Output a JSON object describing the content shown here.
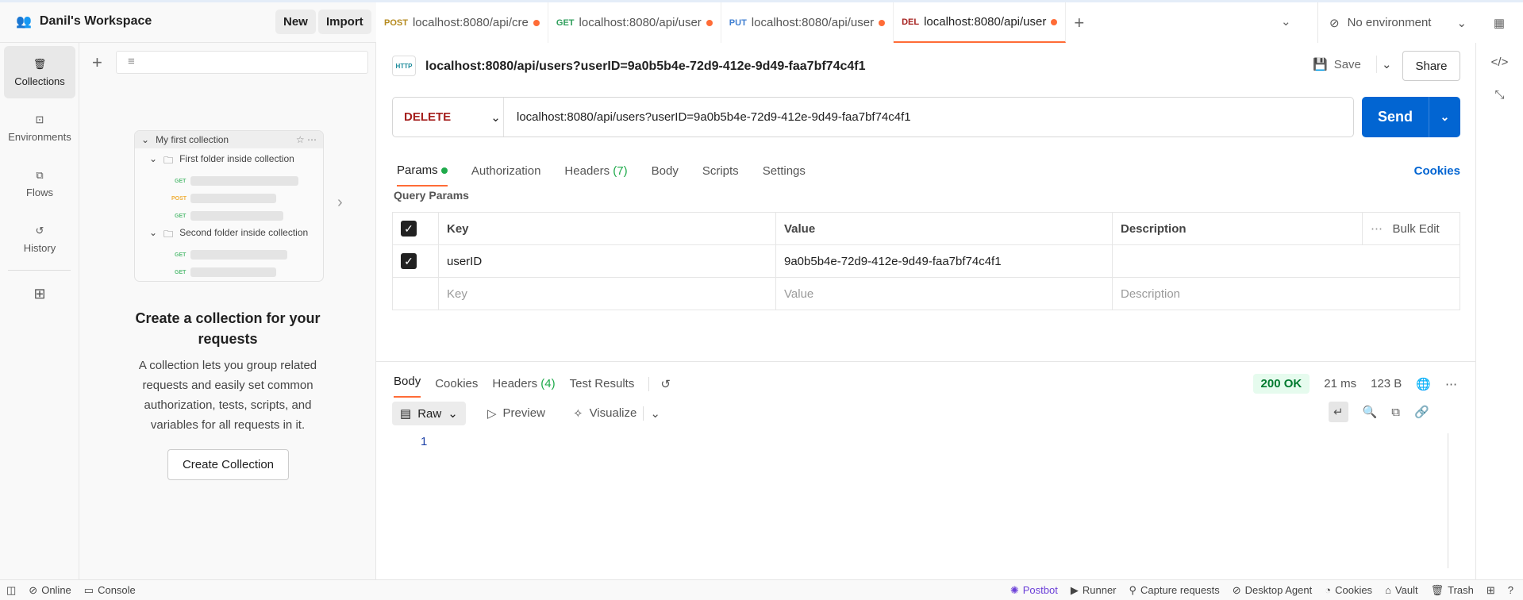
{
  "workspace": {
    "name": "Danil's Workspace",
    "new_label": "New",
    "import_label": "Import"
  },
  "tabs": [
    {
      "method": "POST",
      "url": "localhost:8080/api/cre",
      "color": "#b58a1e"
    },
    {
      "method": "GET",
      "url": "localhost:8080/api/user",
      "color": "#2e9e5b"
    },
    {
      "method": "PUT",
      "url": "localhost:8080/api/user",
      "color": "#3f7fd1"
    },
    {
      "method": "DEL",
      "url": "localhost:8080/api/user",
      "color": "#a5201e"
    }
  ],
  "environment": "No environment",
  "rail": [
    "Collections",
    "Environments",
    "Flows",
    "History"
  ],
  "sidebar": {
    "illustration": {
      "collection": "My first collection",
      "folder1": "First folder inside collection",
      "folder2": "Second folder inside collection",
      "m_get": "GET",
      "m_post": "POST"
    },
    "title": "Create a collection for your requests",
    "description": "A collection lets you group related requests and easily set common authorization, tests, scripts, and variables for all requests in it.",
    "button": "Create Collection"
  },
  "request": {
    "name": "localhost:8080/api/users?userID=9a0b5b4e-72d9-412e-9d49-faa7bf74c4f1",
    "save": "Save",
    "share": "Share",
    "method": "DELETE",
    "url": "localhost:8080/api/users?userID=9a0b5b4e-72d9-412e-9d49-faa7bf74c4f1",
    "send": "Send"
  },
  "req_tabs": {
    "params": "Params",
    "authorization": "Authorization",
    "headers": "Headers",
    "headers_count": "(7)",
    "body": "Body",
    "scripts": "Scripts",
    "settings": "Settings",
    "cookies": "Cookies"
  },
  "query": {
    "label": "Query Params",
    "headers": [
      "Key",
      "Value",
      "Description"
    ],
    "bulk": "Bulk Edit",
    "row": {
      "key": "userID",
      "value": "9a0b5b4e-72d9-412e-9d49-faa7bf74c4f1"
    },
    "placeholders": {
      "key": "Key",
      "value": "Value",
      "description": "Description"
    }
  },
  "response": {
    "tabs": {
      "body": "Body",
      "cookies": "Cookies",
      "headers": "Headers",
      "headers_count": "(4)",
      "tests": "Test Results"
    },
    "status": "200 OK",
    "time": "21 ms",
    "size": "123 B",
    "format": "Raw",
    "preview": "Preview",
    "visualize": "Visualize",
    "line": "1"
  },
  "statusbar": {
    "online": "Online",
    "console": "Console",
    "postbot": "Postbot",
    "runner": "Runner",
    "capture": "Capture requests",
    "agent": "Desktop Agent",
    "cookies": "Cookies",
    "vault": "Vault",
    "trash": "Trash"
  }
}
